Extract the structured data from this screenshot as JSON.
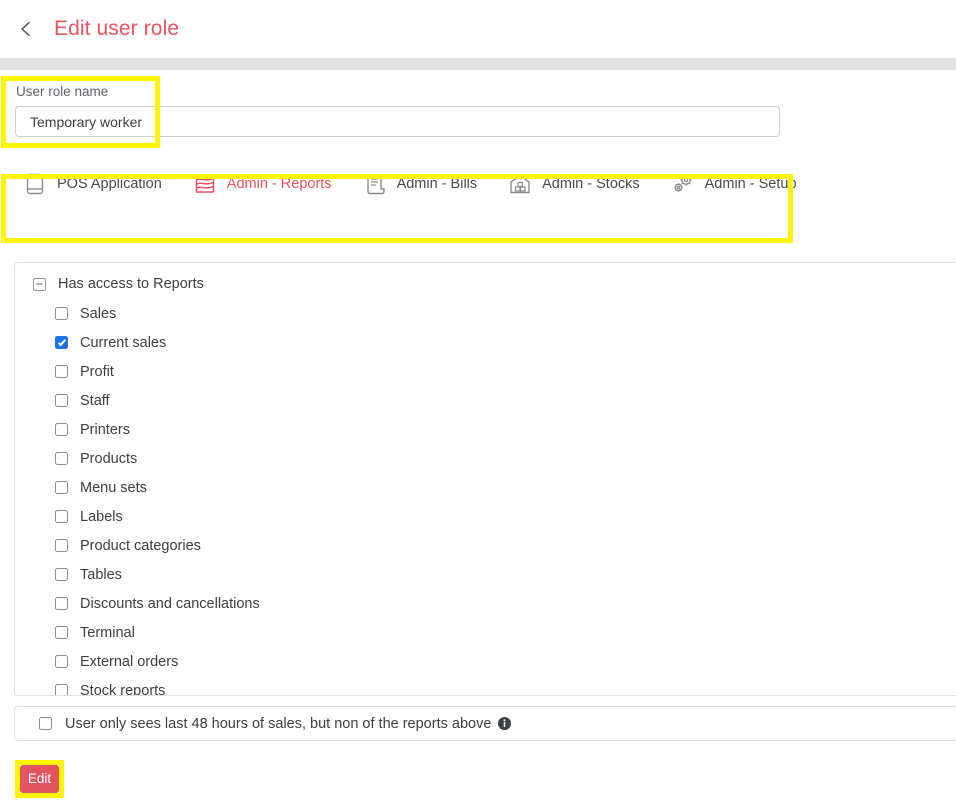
{
  "header": {
    "back_icon": "chevron-left-icon",
    "title": "Edit user role"
  },
  "name_section": {
    "label": "User role name",
    "value": "Temporary worker",
    "placeholder": ""
  },
  "tabs": [
    {
      "label": "POS Application",
      "icon": "tablet-icon",
      "active": false
    },
    {
      "label": "Admin - Reports",
      "icon": "chart-icon",
      "active": true
    },
    {
      "label": "Admin - Bills",
      "icon": "scroll-icon",
      "active": false
    },
    {
      "label": "Admin - Stocks",
      "icon": "warehouse-icon",
      "active": false
    },
    {
      "label": "Admin - Setup",
      "icon": "gears-icon",
      "active": false
    }
  ],
  "permissions": {
    "parent_label": "Has access to Reports",
    "parent_state": "indeterminate",
    "items": [
      {
        "label": "Sales",
        "checked": false
      },
      {
        "label": "Current sales",
        "checked": true
      },
      {
        "label": "Profit",
        "checked": false
      },
      {
        "label": "Staff",
        "checked": false
      },
      {
        "label": "Printers",
        "checked": false
      },
      {
        "label": "Products",
        "checked": false
      },
      {
        "label": "Menu sets",
        "checked": false
      },
      {
        "label": "Labels",
        "checked": false
      },
      {
        "label": "Product categories",
        "checked": false
      },
      {
        "label": "Tables",
        "checked": false
      },
      {
        "label": "Discounts and cancellations",
        "checked": false
      },
      {
        "label": "Terminal",
        "checked": false
      },
      {
        "label": "External orders",
        "checked": false
      },
      {
        "label": "Stock reports",
        "checked": false
      }
    ]
  },
  "note": {
    "label": "User only sees last 48 hours of sales, but non of the reports above",
    "checked": false,
    "info_icon": "info-icon"
  },
  "actions": {
    "edit_label": "Edit"
  },
  "colors": {
    "accent": "#e8545f",
    "button": "#e0555f",
    "checkbox_checked": "#1a73e8",
    "annotation": "#fff500",
    "divider": "#e4e4e4"
  }
}
